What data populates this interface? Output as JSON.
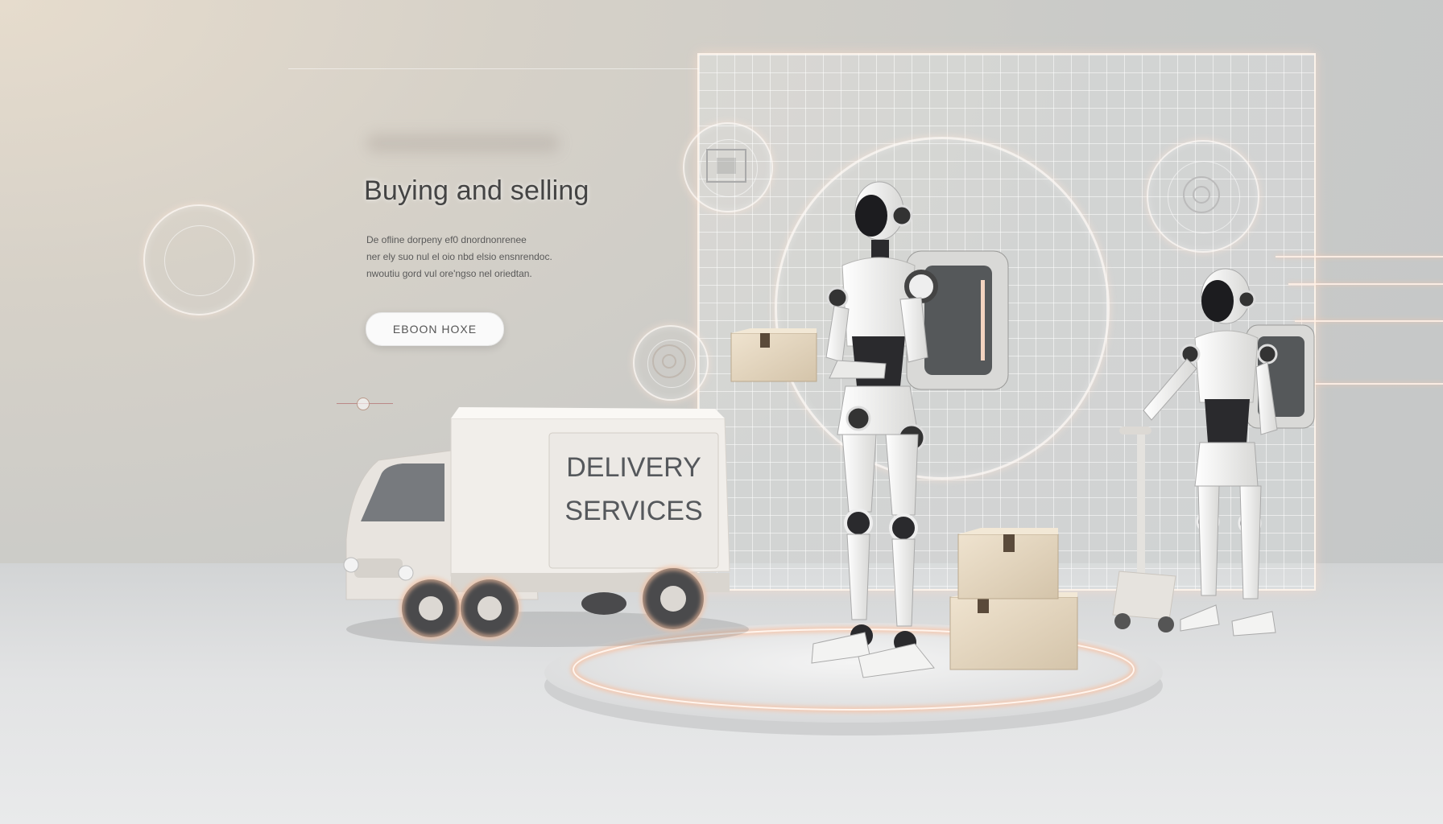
{
  "hero": {
    "title": "Buying and selling",
    "description_lines": [
      "De  ofline  dorpeny  ef0  dnordnonrenee",
      "ner ely suo  nul  el oio  nbd elsio  ensnrendoc.",
      "nwoutiu  gord  vul ore'ngso  nel  oriedtan."
    ],
    "cta_label": "EBOON HOXE"
  },
  "truck": {
    "line1": "DELIVERY",
    "line2": "SERVICES"
  },
  "colors": {
    "glow": "#f4c8b0",
    "robot_white": "#f2f2f0",
    "robot_dark": "#1f1f22",
    "box": "#e4d6c0"
  }
}
